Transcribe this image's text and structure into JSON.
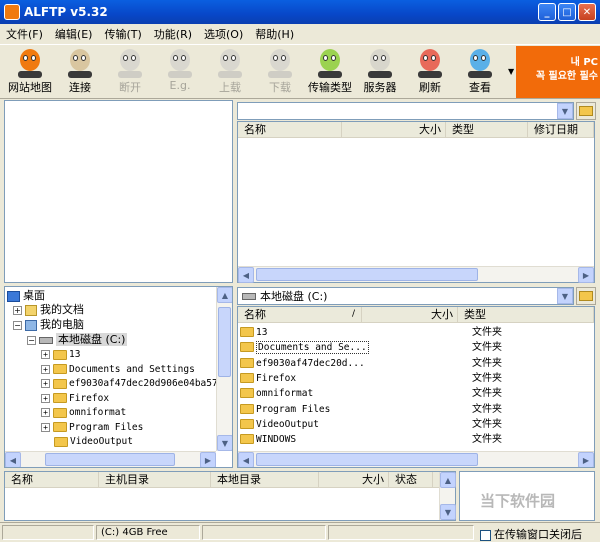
{
  "window": {
    "title": "ALFTP v5.32"
  },
  "menu": [
    "文件(F)",
    "编辑(E)",
    "传输(T)",
    "功能(R)",
    "选项(O)",
    "帮助(H)"
  ],
  "toolbar": [
    {
      "label": "网站地图",
      "icon": "site-map-icon",
      "enabled": true,
      "color": "#f07a10"
    },
    {
      "label": "连接",
      "icon": "connect-icon",
      "enabled": true,
      "color": "#d9c6a0"
    },
    {
      "label": "断开",
      "icon": "disconnect-icon",
      "enabled": false,
      "color": "#d9d7cf"
    },
    {
      "label": "E.g.",
      "icon": "eg-icon",
      "enabled": false,
      "color": "#d9d7cf"
    },
    {
      "label": "上载",
      "icon": "upload-icon",
      "enabled": false,
      "color": "#d9d7cf"
    },
    {
      "label": "下载",
      "icon": "download-icon",
      "enabled": false,
      "color": "#d9d7cf"
    },
    {
      "label": "传输类型",
      "icon": "transfer-type-icon",
      "enabled": true,
      "color": "#9bd250"
    },
    {
      "label": "服务器",
      "icon": "server-icon",
      "enabled": true,
      "color": "#d8d6cc"
    },
    {
      "label": "刷新",
      "icon": "refresh-icon",
      "enabled": true,
      "color": "#e86a5a"
    },
    {
      "label": "查看",
      "icon": "view-icon",
      "enabled": true,
      "color": "#5ab0e8"
    }
  ],
  "ad": {
    "line1": "내 PC",
    "line2": "꼭 필요한 필수"
  },
  "remote": {
    "path": "",
    "columns": [
      "名称",
      "大小",
      "类型",
      "修订日期"
    ]
  },
  "local": {
    "path": "本地磁盘 (C:)",
    "columns": [
      "名称",
      "大小",
      "类型"
    ],
    "files": [
      {
        "name": "13",
        "type": "文件夹"
      },
      {
        "name": "Documents and Se...",
        "type": "文件夹"
      },
      {
        "name": "ef9030af47dec20d...",
        "type": "文件夹"
      },
      {
        "name": "Firefox",
        "type": "文件夹"
      },
      {
        "name": "omniformat",
        "type": "文件夹"
      },
      {
        "name": "Program Files",
        "type": "文件夹"
      },
      {
        "name": "VideoOutput",
        "type": "文件夹"
      },
      {
        "name": "WINDOWS",
        "type": "文件夹"
      }
    ]
  },
  "tree": {
    "root": "桌面",
    "my_documents": "我的文档",
    "my_computer": "我的电脑",
    "drive": "本地磁盘 (C:)",
    "folders": [
      "13",
      "Documents and Settings",
      "ef9030af47dec20d906e04ba57",
      "Firefox",
      "omniformat",
      "Program Files",
      "VideoOutput"
    ]
  },
  "queue": {
    "columns": [
      "名称",
      "主机目录",
      "本地目录",
      "大小",
      "状态"
    ]
  },
  "status": {
    "drive_info": "(C:)  4GB Free",
    "close_after": "在传输窗口关闭后"
  },
  "watermark": "当下软件园"
}
